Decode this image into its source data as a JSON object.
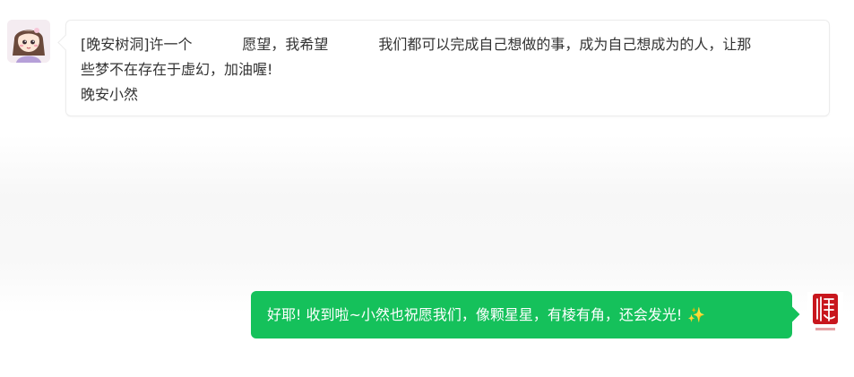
{
  "conversation": {
    "received": {
      "lines": [
        "[晚安树洞]许一个           愿望，我希望           我们都可以完成自己想做的事，成为自己想成为的人，让那",
        "些梦不在存在于虚幻，加油喔!",
        "晚安小然"
      ]
    },
    "sent": {
      "text": "好耶! 收到啦~小然也祝愿我们，像颗星星，有棱有角，还会发光!",
      "emoji": "✨"
    }
  },
  "icons": {
    "left_avatar": "cartoon-girl-avatar",
    "right_avatar": "red-seal-logo-avatar"
  },
  "colors": {
    "sent_bubble": "#15c15b",
    "seal_red": "#c8161d"
  }
}
